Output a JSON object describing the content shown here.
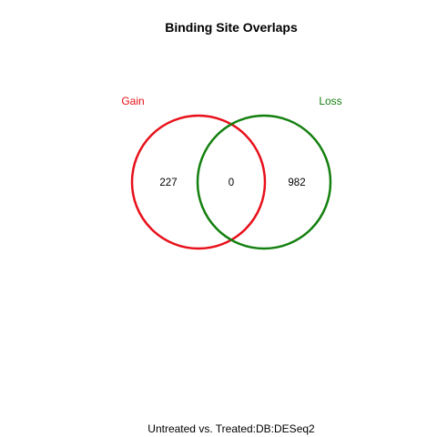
{
  "title": "Binding Site Overlaps",
  "subtitle": "Untreated vs. Treated:DB:DESeq2",
  "sets": [
    {
      "name": "Gain",
      "color": "#e8101a"
    },
    {
      "name": "Loss",
      "color": "#14800f"
    }
  ],
  "counts": {
    "gain_only": "227",
    "overlap": "0",
    "loss_only": "982"
  }
}
